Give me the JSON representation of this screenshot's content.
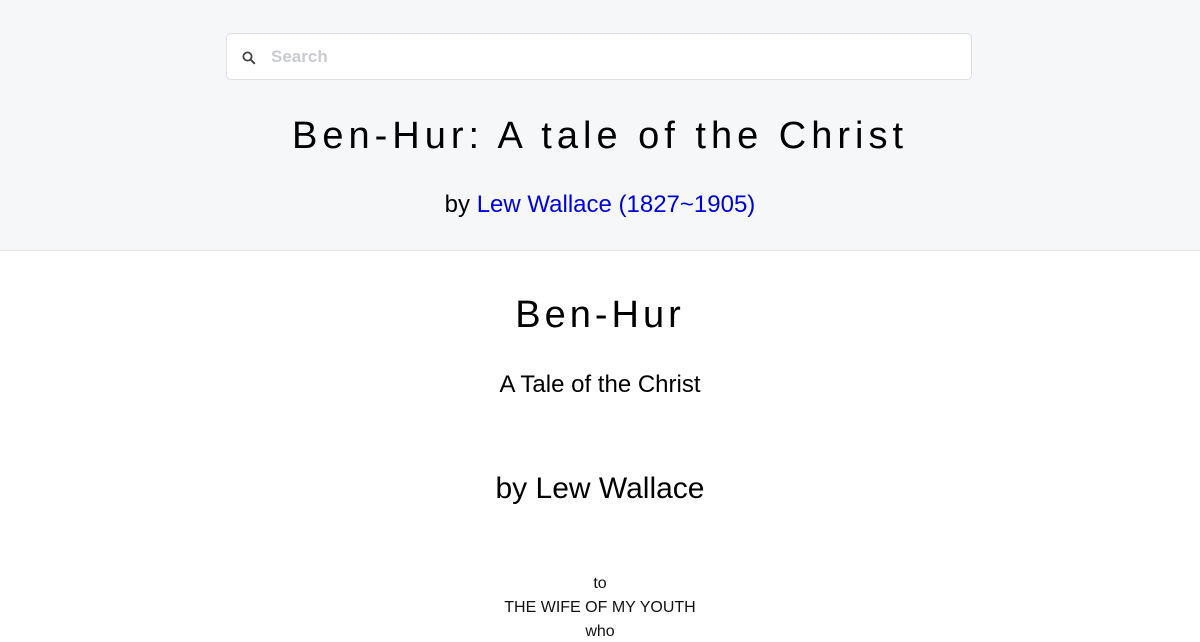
{
  "search": {
    "placeholder": "Search",
    "icon": "search-icon"
  },
  "header": {
    "title": "Ben-Hur: A tale of the Christ",
    "by_prefix": "by",
    "author_link": "Lew Wallace (1827~1905)",
    "link_color": "#0000dd"
  },
  "content": {
    "title": "Ben-Hur",
    "subtitle": "A Tale of the Christ",
    "author_line": "by Lew Wallace",
    "dedication": [
      "to",
      "THE WIFE OF MY YOUTH",
      "who"
    ]
  }
}
